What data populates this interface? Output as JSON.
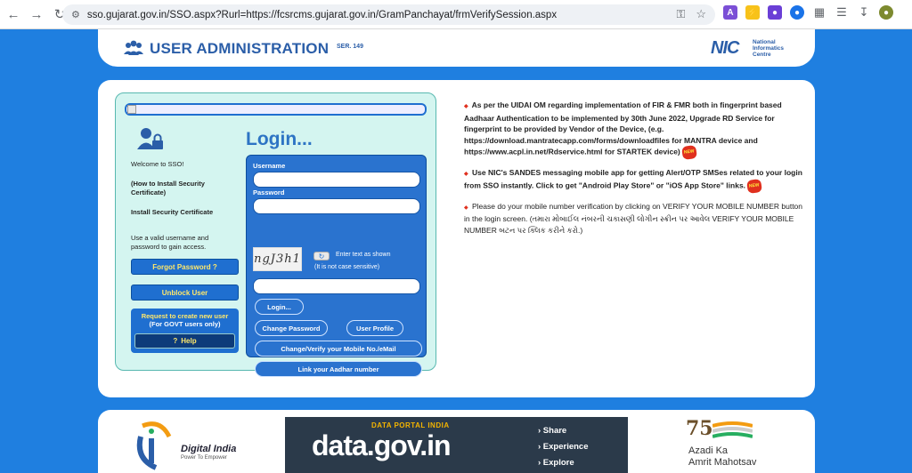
{
  "browser": {
    "url": "sso.gujarat.gov.in/SSO.aspx?Rurl=https://fcsrcms.gujarat.gov.in/GramPanchayat/frmVerifySession.aspx",
    "extension_letter": "A"
  },
  "header": {
    "title": "USER ADMINISTRATION",
    "ser": "SER. 149",
    "logo_text": "NIC",
    "logo_line1": "National",
    "logo_line2": "Informatics",
    "logo_line3": "Centre"
  },
  "login_panel": {
    "title": "Login...",
    "welcome": "Welcome to SSO!",
    "install_link": "(How to Install Security Certificate)",
    "install_cert": "Install Security Certificate",
    "hint": "Use a valid username and password to gain access.",
    "forgot_password": "Forgot Password ?",
    "unblock_user": "Unblock User",
    "request_line1": "Request to create new user",
    "request_line2": "(For GOVT users only)",
    "help": "Help"
  },
  "form": {
    "username_label": "Username",
    "password_label": "Password",
    "username_value": "",
    "password_value": "",
    "captcha_text": "ngJ3h1",
    "captcha_hint1": "Enter text as shown",
    "captcha_hint2": "(It is not case sensitive)",
    "captcha_value": "",
    "login_button": "Login...",
    "change_password": "Change Password",
    "user_profile": "User Profile",
    "verify_mobile": "Change/Verify your Mobile No./eMail",
    "link_aadhar": "Link your Aadhar number"
  },
  "notices": [
    {
      "text": "As per the UIDAI OM regarding implementation of FIR & FMR both in fingerprint based Aadhaar Authentication to be implemented by 30th June 2022, Upgrade RD Service for fingerprint to be provided by Vendor of the Device, (e.g. https://download.mantratecapp.com/forms/downloadfiles for MANTRA device and https://www.acpl.in.net/Rdservice.html for STARTEK device)",
      "badge": "NEW"
    },
    {
      "text": "Use NIC's SANDES messaging mobile app for getting Alert/OTP SMSes related to your login from SSO instantly. Click to get \"Android Play Store\" or \"iOS App Store\" links.",
      "badge": "NEW"
    },
    {
      "text": "Please do your mobile number verification by clicking on VERIFY YOUR MOBILE NUMBER button in the login screen. (તમારા મોબાઈલ નંબરની ચકાસણી લોગીન સ્ક્રીન પર આવેલ VERIFY YOUR MOBILE NUMBER બટન પર ક્લિક કરીને કરો.)"
    }
  ],
  "footer": {
    "digital_india": "Digital India",
    "digital_india_tag": "Power To Empower",
    "data_portal": "DATA PORTAL INDIA",
    "data_gov": "data.gov.in",
    "share": "› Share",
    "experience": "› Experience",
    "explore": "› Explore",
    "amrit_75": "75",
    "amrit_line1": "Azadi Ka",
    "amrit_line2": "Amrit Mahotsav"
  },
  "colors": {
    "page_bg": "#1f7fe0",
    "accent_blue": "#2a73cf",
    "panel_bg": "#d4f5f0",
    "button_text_yellow": "#ffe86b",
    "badge_red": "#e0301e"
  }
}
